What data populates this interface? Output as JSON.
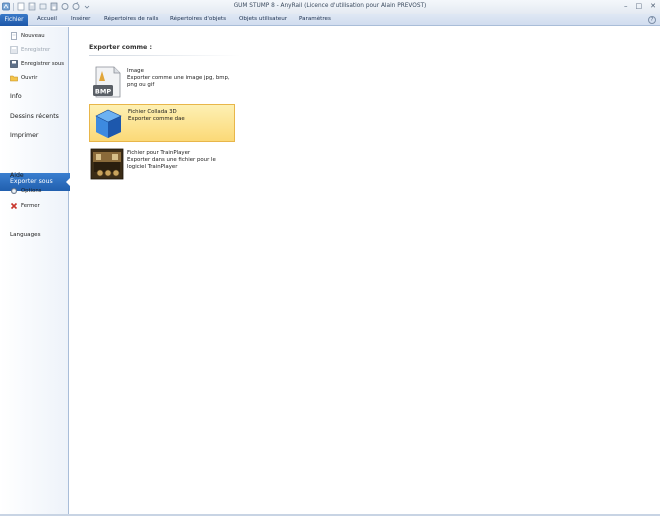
{
  "window": {
    "title": "GUM STUMP 8 - AnyRail (Licence d'utilisation pour Alain PREVOST)",
    "minimize": "–",
    "maximize": "□",
    "close": "✕"
  },
  "quick_access": [
    "app-icon",
    "new-icon",
    "save-icon",
    "open-icon",
    "save-as-icon",
    "undo-icon",
    "redo-icon",
    "dropdown-icon"
  ],
  "ribbon": {
    "file_tab": "Fichier",
    "tabs": [
      "Accueil",
      "Insérer",
      "Répertoires de rails",
      "Répertoires d'objets",
      "Objets utilisateur",
      "Paramètres"
    ],
    "help": "?"
  },
  "backstage": {
    "commands_top": [
      {
        "label": "Nouveau",
        "icon": "new-document-icon",
        "enabled": true
      },
      {
        "label": "Enregistrer",
        "icon": "save-icon",
        "enabled": false
      },
      {
        "label": "Enregistrer sous",
        "icon": "save-as-icon",
        "enabled": true
      },
      {
        "label": "Ouvrir",
        "icon": "open-folder-icon",
        "enabled": true
      }
    ],
    "tabs": [
      "Info",
      "Dessins récents",
      "Imprimer"
    ],
    "active_tab": "Exporter sous",
    "help_tab": "Aide",
    "commands_bottom": [
      {
        "label": "Options",
        "icon": "options-icon"
      },
      {
        "label": "Fermer",
        "icon": "close-icon"
      }
    ],
    "languages": "Languages"
  },
  "export": {
    "heading": "Exporter comme :",
    "options": [
      {
        "title": "Image",
        "desc": "Exporter comme une image jpg, bmp, png ou gif",
        "icon": "bmp-image-icon",
        "selected": false
      },
      {
        "title": "Fichier Collada 3D",
        "desc": "Exporter comme dae",
        "icon": "collada-cube-icon",
        "selected": true
      },
      {
        "title": "Fichier pour TrainPlayer",
        "desc": "Exporter dans une fichier pour le logiciel TrainPlayer",
        "icon": "trainplayer-icon",
        "selected": false
      }
    ]
  },
  "colors": {
    "accent": "#215fae",
    "selected_fill": "#fbd977",
    "selected_border": "#e8b64a"
  }
}
